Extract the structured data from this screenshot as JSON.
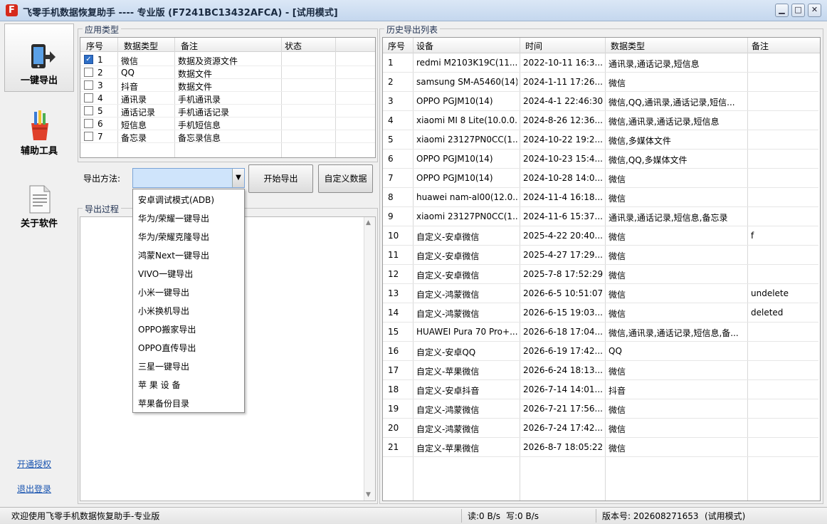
{
  "window": {
    "title": "飞零手机数据恢复助手 ---- 专业版 (F7241BC13432AFCA) - [试用模式]",
    "icon_letter": "F",
    "minimize_glyph": "▁",
    "maximize_glyph": "□",
    "close_glyph": "✕"
  },
  "sidebar": {
    "items": [
      {
        "label": "一键导出",
        "icon": "phone-export-icon"
      },
      {
        "label": "辅助工具",
        "icon": "tools-icon"
      },
      {
        "label": "关于软件",
        "icon": "document-icon"
      }
    ],
    "links": [
      "开通授权",
      "退出登录"
    ]
  },
  "app_types": {
    "group_title": "应用类型",
    "columns": [
      "序号",
      "数据类型",
      "备注",
      "状态"
    ],
    "rows": [
      {
        "index": "1",
        "type": "微信",
        "note": "数据及资源文件",
        "status": "",
        "checked": true
      },
      {
        "index": "2",
        "type": "QQ",
        "note": "数据文件",
        "status": "",
        "checked": false
      },
      {
        "index": "3",
        "type": "抖音",
        "note": "数据文件",
        "status": "",
        "checked": false
      },
      {
        "index": "4",
        "type": "通讯录",
        "note": "手机通讯录",
        "status": "",
        "checked": false
      },
      {
        "index": "5",
        "type": "通话记录",
        "note": "手机通话记录",
        "status": "",
        "checked": false
      },
      {
        "index": "6",
        "type": "短信息",
        "note": "手机短信息",
        "status": "",
        "checked": false
      },
      {
        "index": "7",
        "type": "备忘录",
        "note": "备忘录信息",
        "status": "",
        "checked": false
      }
    ]
  },
  "export": {
    "method_label": "导出方法:",
    "method_value": "",
    "start_button": "开始导出",
    "custom_button": "自定义数据",
    "options": [
      "安卓调试模式(ADB)",
      "华为/荣耀一键导出",
      "华为/荣耀克隆导出",
      "鸿蒙Next一键导出",
      "VIVO一键导出",
      "小米一键导出",
      "小米换机导出",
      "OPPO搬家导出",
      "OPPO直传导出",
      "三星一键导出",
      "苹 果 设 备",
      "苹果备份目录"
    ]
  },
  "process": {
    "group_title": "导出过程"
  },
  "history": {
    "group_title": "历史导出列表",
    "columns": [
      "序号",
      "设备",
      "时间",
      "数据类型",
      "备注"
    ],
    "rows": [
      {
        "index": "1",
        "device": "redmi M2103K19C(11....",
        "time": "2022-10-11 16:3...",
        "type": "通讯录,通话记录,短信息",
        "note": ""
      },
      {
        "index": "2",
        "device": "samsung SM-A5460(14)",
        "time": "2024-1-11 17:26...",
        "type": "微信",
        "note": ""
      },
      {
        "index": "3",
        "device": "OPPO PGJM10(14)",
        "time": "2024-4-1 22:46:30",
        "type": "微信,QQ,通讯录,通话记录,短信...",
        "note": ""
      },
      {
        "index": "4",
        "device": "xiaomi MI 8 Lite(10.0.0...",
        "time": "2024-8-26 12:36...",
        "type": "微信,通讯录,通话记录,短信息",
        "note": ""
      },
      {
        "index": "5",
        "device": "xiaomi 23127PN0CC(1...",
        "time": "2024-10-22 19:2...",
        "type": "微信,多媒体文件",
        "note": ""
      },
      {
        "index": "6",
        "device": "OPPO PGJM10(14)",
        "time": "2024-10-23 15:4...",
        "type": "微信,QQ,多媒体文件",
        "note": ""
      },
      {
        "index": "7",
        "device": "OPPO PGJM10(14)",
        "time": "2024-10-28 14:0...",
        "type": "微信",
        "note": ""
      },
      {
        "index": "8",
        "device": "huawei nam-al00(12.0....",
        "time": "2024-11-4 16:18...",
        "type": "微信",
        "note": ""
      },
      {
        "index": "9",
        "device": "xiaomi 23127PN0CC(1...",
        "time": "2024-11-6 15:37...",
        "type": "通讯录,通话记录,短信息,备忘录",
        "note": ""
      },
      {
        "index": "10",
        "device": "自定义-安卓微信",
        "time": "2025-4-22 20:40...",
        "type": "微信",
        "note": "f"
      },
      {
        "index": "11",
        "device": "自定义-安卓微信",
        "time": "2025-4-27 17:29...",
        "type": "微信",
        "note": ""
      },
      {
        "index": "12",
        "device": "自定义-安卓微信",
        "time": "2025-7-8 17:52:29",
        "type": "微信",
        "note": ""
      },
      {
        "index": "13",
        "device": "自定义-鸿蒙微信",
        "time": "2026-6-5 10:51:07",
        "type": "微信",
        "note": "undelete"
      },
      {
        "index": "14",
        "device": "自定义-鸿蒙微信",
        "time": "2026-6-15 19:03...",
        "type": "微信",
        "note": "deleted"
      },
      {
        "index": "15",
        "device": "HUAWEI Pura 70 Pro+...",
        "time": "2026-6-18 17:04...",
        "type": "微信,通讯录,通话记录,短信息,备...",
        "note": ""
      },
      {
        "index": "16",
        "device": "自定义-安卓QQ",
        "time": "2026-6-19 17:42...",
        "type": "QQ",
        "note": ""
      },
      {
        "index": "17",
        "device": "自定义-苹果微信",
        "time": "2026-6-24 18:13...",
        "type": "微信",
        "note": ""
      },
      {
        "index": "18",
        "device": "自定义-安卓抖音",
        "time": "2026-7-14 14:01...",
        "type": "抖音",
        "note": ""
      },
      {
        "index": "19",
        "device": "自定义-鸿蒙微信",
        "time": "2026-7-21 17:56...",
        "type": "微信",
        "note": ""
      },
      {
        "index": "20",
        "device": "自定义-鸿蒙微信",
        "time": "2026-7-24 17:42...",
        "type": "微信",
        "note": ""
      },
      {
        "index": "21",
        "device": "自定义-苹果微信",
        "time": "2026-8-7 18:05:22",
        "type": "微信",
        "note": ""
      }
    ]
  },
  "statusbar": {
    "welcome": "欢迎使用飞零手机数据恢复助手-专业版",
    "read": "读:0 B/s",
    "write": "写:0 B/s",
    "version": "版本号: 202608271653",
    "mode": "(试用模式)"
  },
  "colors": {
    "accent": "#2e6fc7",
    "dropdown_bg": "#cfe4fb",
    "link": "#1a55b0",
    "brand": "#d62a1c"
  }
}
